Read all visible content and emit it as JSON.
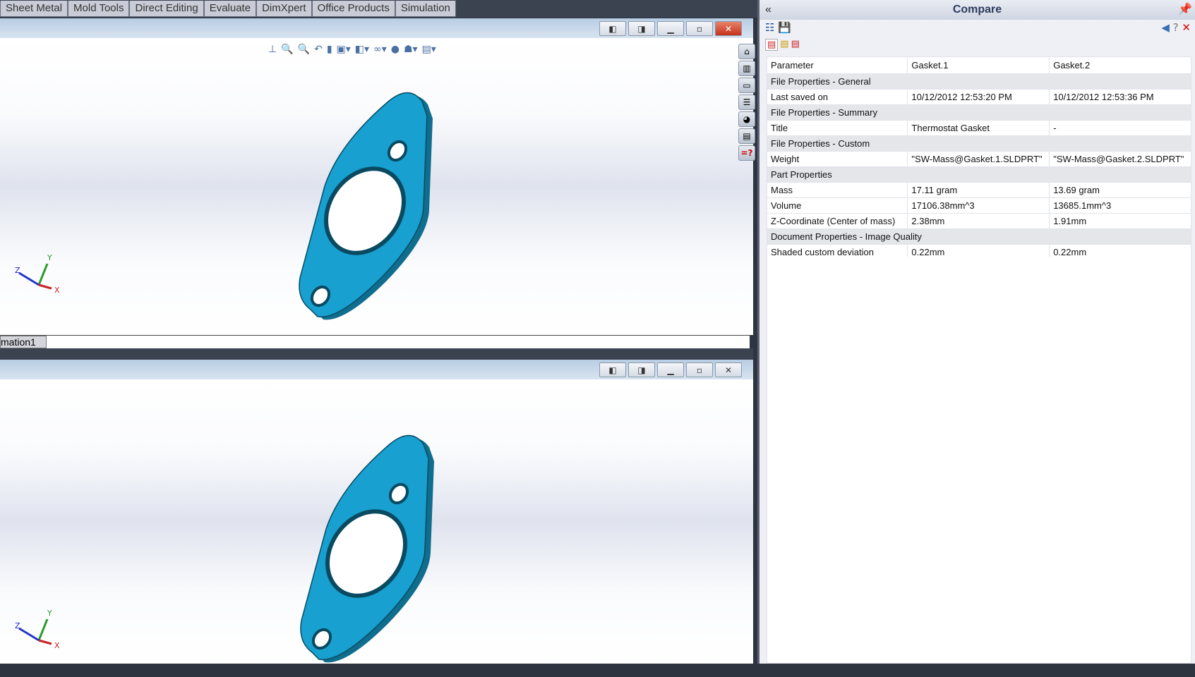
{
  "tabs": [
    "Sheet Metal",
    "Mold Tools",
    "Direct Editing",
    "Evaluate",
    "DimXpert",
    "Office Products",
    "Simulation"
  ],
  "upper": {
    "config_tab": "mation1"
  },
  "compare": {
    "title": "Compare",
    "columns": [
      "Parameter",
      "Gasket.1",
      "Gasket.2"
    ],
    "rows": [
      {
        "section": "File Properties - General"
      },
      {
        "cells": [
          "Last saved on",
          "10/12/2012 12:53:20 PM",
          "10/12/2012 12:53:36 PM"
        ]
      },
      {
        "section": "File Properties - Summary"
      },
      {
        "cells": [
          "Title",
          "Thermostat Gasket",
          "-"
        ]
      },
      {
        "section": "File Properties - Custom"
      },
      {
        "cells": [
          "Weight",
          "\"SW-Mass@Gasket.1.SLDPRT\"",
          "\"SW-Mass@Gasket.2.SLDPRT\""
        ]
      },
      {
        "section": "Part Properties"
      },
      {
        "cells": [
          "Mass",
          "17.11 gram",
          "13.69 gram"
        ]
      },
      {
        "cells": [
          "Volume",
          "17106.38mm^3",
          "13685.1mm^3"
        ]
      },
      {
        "cells": [
          "Z-Coordinate (Center of mass)",
          "2.38mm",
          "1.91mm"
        ]
      },
      {
        "section": "Document Properties - Image Quality"
      },
      {
        "cells": [
          "Shaded custom deviation",
          "0.22mm",
          "0.22mm"
        ]
      }
    ]
  },
  "triad": {
    "x": "X",
    "y": "Y",
    "z": "Z"
  },
  "colors": {
    "gasket": "#17a0d0",
    "gasket_edge": "#0f6d8e"
  }
}
